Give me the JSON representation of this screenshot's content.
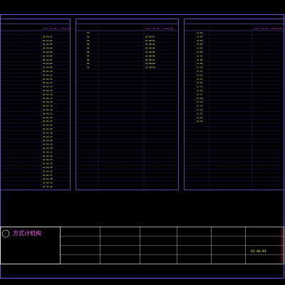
{
  "colors": {
    "background": "#000000",
    "frame": "#6a5acd",
    "header_text": "#ff3cff",
    "row_text": "#ffff66",
    "title_text": "#ff66ff",
    "grid_line": "#2a2a7a",
    "accent_red": "#ff2020",
    "title_block_text": "#ffffff"
  },
  "panels": [
    {
      "id": "panel-left",
      "heading": "",
      "col_headers": [
        "",
        "(Ref. ID No.) Sheet No."
      ],
      "rows": [
        [
          "",
          ""
        ],
        [
          "",
          "A2-AA-01"
        ],
        [
          "",
          "A2-AA-02"
        ],
        [
          "",
          "A2-AA-03"
        ],
        [
          "",
          "A2-AA-04"
        ],
        [
          "",
          "A2-AA-05"
        ],
        [
          "",
          "A2-AA-06"
        ],
        [
          "",
          "A2-AA-07"
        ],
        [
          "",
          "A2-AA-08"
        ],
        [
          "",
          "A2-AA-09"
        ],
        [
          "",
          "A2-AA-10"
        ],
        [
          "",
          "A2-AA-11"
        ],
        [
          "",
          "A2-AA-12"
        ],
        [
          "",
          "A2-AA-13"
        ],
        [
          "",
          "A2-AA-14"
        ],
        [
          "",
          "A2-AA-15"
        ],
        [
          "",
          "A2-AA-16"
        ],
        [
          "",
          "A2-AA-17"
        ],
        [
          "",
          "A2-AA-18"
        ],
        [
          "",
          "A2-AA-19"
        ],
        [
          "",
          "A2-AA-20"
        ],
        [
          "",
          "A2-AA-21"
        ],
        [
          "",
          "A2-AA-22"
        ],
        [
          "",
          "A2-AA-23"
        ],
        [
          "",
          "A2-AA-24"
        ],
        [
          "",
          "A2-AA-25"
        ],
        [
          "",
          "A2-AA-26"
        ],
        [
          "",
          "A2-AA-27"
        ],
        [
          "",
          "A2-AA-28"
        ],
        [
          "",
          "A2-AA-29"
        ],
        [
          "",
          "A2-AA-30"
        ],
        [
          "",
          "A2-AA-31"
        ],
        [
          "",
          "A2-AA-32"
        ],
        [
          "",
          "A2-AA-33"
        ],
        [
          "",
          "A2-AA-34"
        ],
        [
          "",
          "A2-AA-35"
        ],
        [
          "",
          "A2-AA-36"
        ],
        [
          "",
          "A2-AA-37"
        ],
        [
          "",
          "A2-AA-38"
        ],
        [
          "",
          "A2-AA-39"
        ],
        [
          "",
          "A2-AA-40"
        ],
        [
          "",
          "A2-AA-41"
        ]
      ]
    },
    {
      "id": "panel-middle",
      "heading": "",
      "col_headers": [
        "",
        "",
        "(Ref. ID No.) Sheet No."
      ],
      "rows": [
        [
          "01",
          "",
          ""
        ],
        [
          "02",
          "",
          "A2-AB-01"
        ],
        [
          "03",
          "",
          "A2-AB-02"
        ],
        [
          "04",
          "",
          "A2-AB-03"
        ],
        [
          "05",
          "",
          "A2-AB-04"
        ],
        [
          "06",
          "",
          "A2-AB-05"
        ],
        [
          "07",
          "",
          "A2-AB-06"
        ],
        [
          "08",
          "",
          "A2-AB-07"
        ],
        [
          "09",
          "",
          "A2-AB-08"
        ],
        [
          "10",
          "",
          "A2-AB-09"
        ]
      ]
    },
    {
      "id": "panel-right",
      "heading": "",
      "col_headers": [
        "",
        "",
        "(Ref. ID No.) Sheet No."
      ],
      "rows": [
        [
          "11-01",
          ""
        ],
        [
          "11-02",
          ""
        ],
        [
          "11-03",
          ""
        ],
        [
          "11-04",
          ""
        ],
        [
          "11-05",
          ""
        ],
        [
          "11-06",
          ""
        ],
        [
          "11-07",
          ""
        ],
        [
          "11-08",
          ""
        ],
        [
          "11-09",
          ""
        ],
        [
          "11-10",
          ""
        ],
        [
          "11-11",
          ""
        ],
        [
          "11-12",
          ""
        ],
        [
          "11-13",
          ""
        ],
        [
          "11-14",
          ""
        ],
        [
          "11-15",
          ""
        ],
        [
          "11-16",
          ""
        ],
        [
          "11-17",
          ""
        ],
        [
          "11-18",
          ""
        ],
        [
          "11-19",
          ""
        ],
        [
          "11-20",
          ""
        ],
        [
          "11-21",
          ""
        ],
        [
          "11-22",
          ""
        ],
        [
          "11-23",
          ""
        ],
        [
          "11-24",
          ""
        ]
      ]
    }
  ],
  "title_block": {
    "firm_name": "方式计机构",
    "firm_sub1": "",
    "firm_sub2": "",
    "firm_sub3": "",
    "fields": [
      {
        "label": "",
        "value": ""
      },
      {
        "label": "",
        "value": ""
      },
      {
        "label": "",
        "value": ""
      },
      {
        "label": "",
        "value": ""
      },
      {
        "label": "",
        "value": ""
      },
      {
        "label": "",
        "value": ""
      },
      {
        "label": "",
        "value": ""
      },
      {
        "label": "",
        "value": ""
      }
    ],
    "sheet_title": "",
    "sheet_number": "A2-AA-01"
  }
}
